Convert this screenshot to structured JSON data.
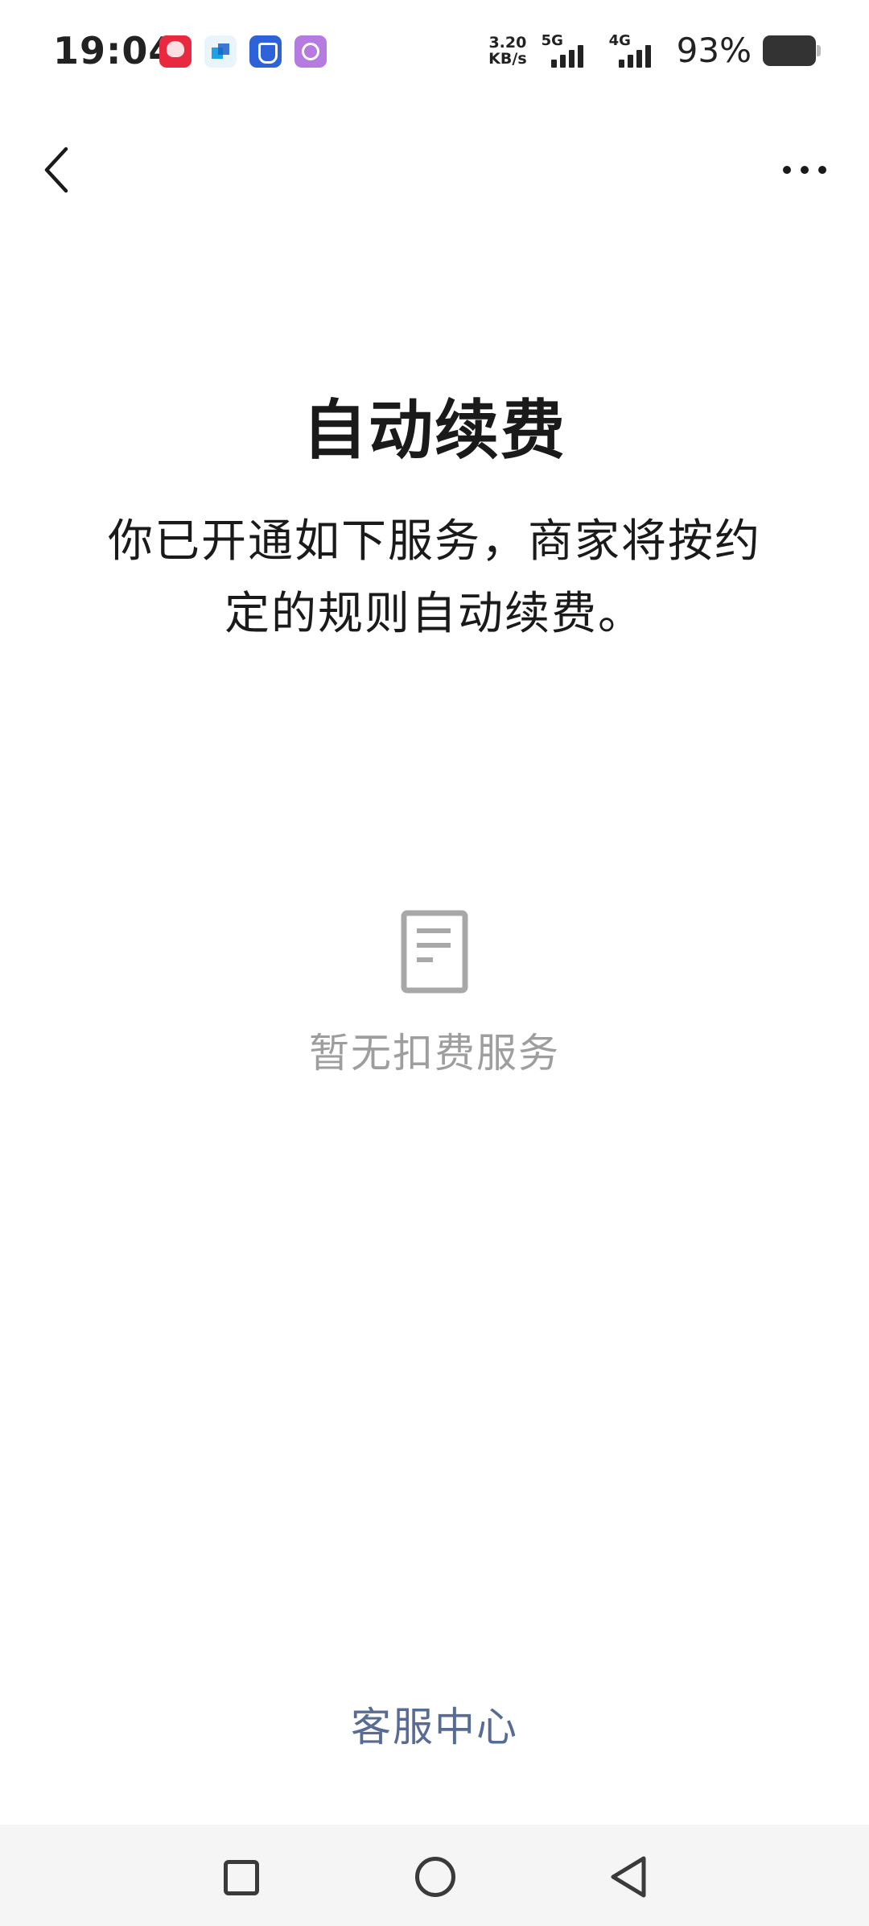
{
  "status_bar": {
    "time": "19:04",
    "net_speed_value": "3.20",
    "net_speed_unit": "KB/s",
    "signal_1_type": "5G",
    "signal_2_type": "4G",
    "battery_percent": "93%"
  },
  "notification_icons": [
    "pinduoduo-app-icon",
    "blue-squares-app-icon",
    "shield-app-icon",
    "purple-app-icon"
  ],
  "header": {
    "back_icon": "chevron-left-icon",
    "more_icon": "more-dots-icon"
  },
  "main": {
    "title": "自动续费",
    "description": "你已开通如下服务，商家将按约定的规则自动续费。",
    "empty_icon": "document-icon",
    "empty_text": "暂无扣费服务"
  },
  "footer": {
    "help_center_label": "客服中心"
  },
  "system_nav": {
    "recents_icon": "square-recents-icon",
    "home_icon": "circle-home-icon",
    "back_icon": "triangle-back-icon"
  },
  "colors": {
    "background": "#ffffff",
    "text_primary": "#1a1a1a",
    "text_muted": "#9e9e9e",
    "link": "#576b95",
    "system_nav_bg": "#f5f5f5"
  }
}
